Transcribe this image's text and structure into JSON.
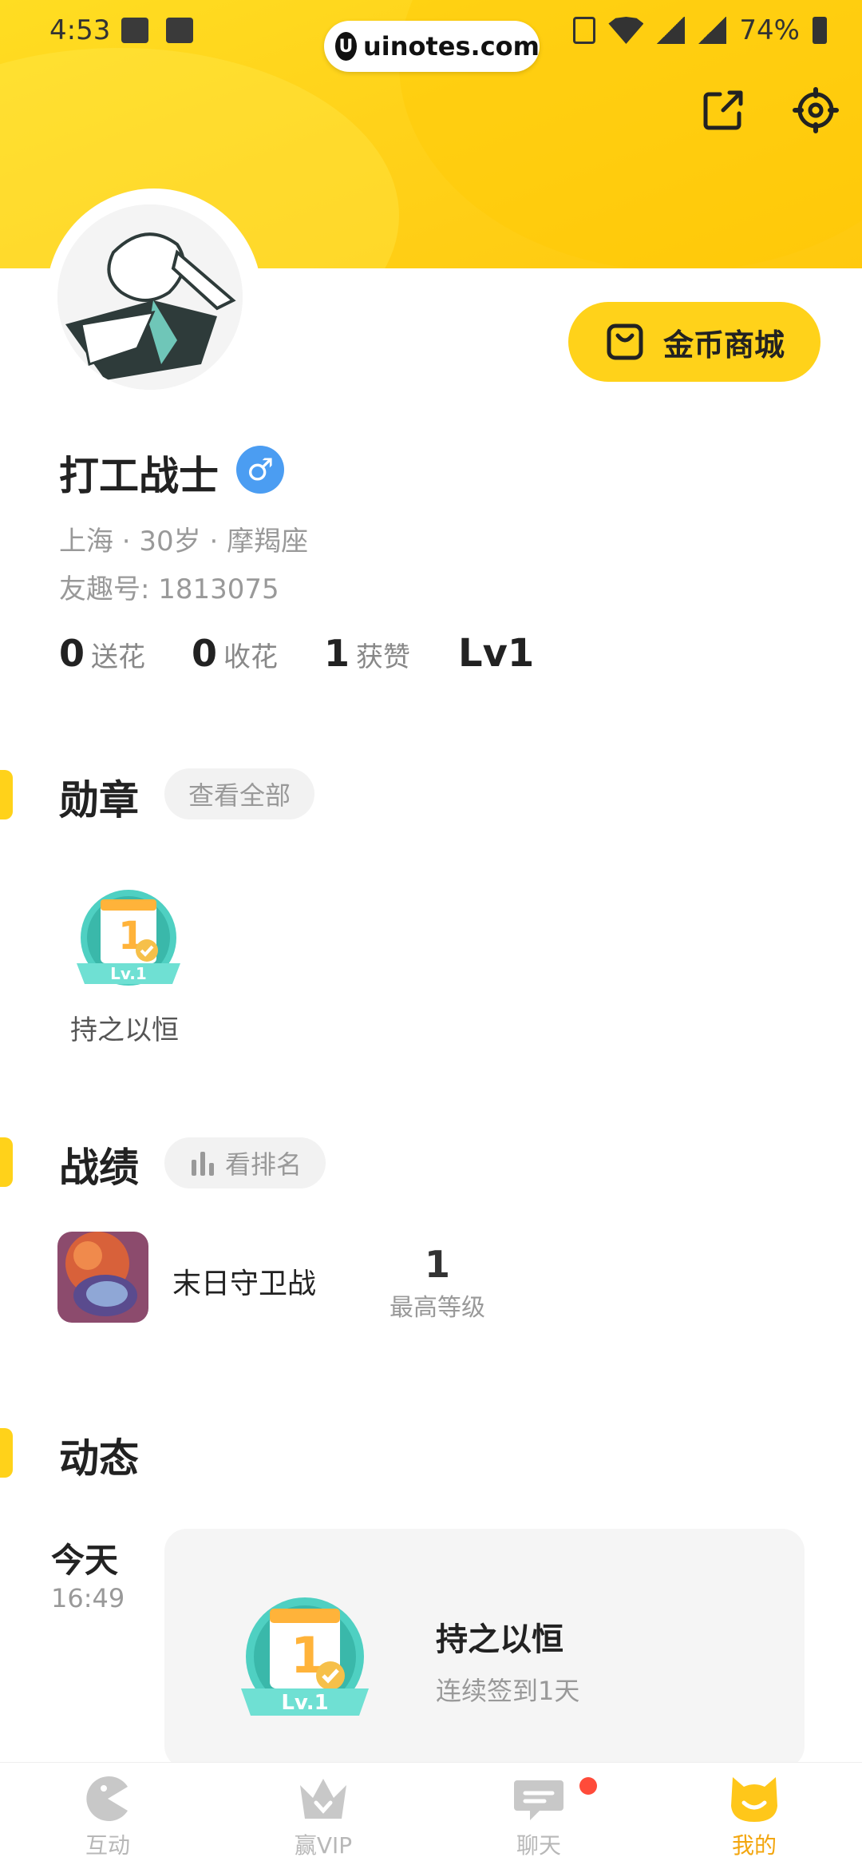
{
  "status_bar": {
    "time": "4:53",
    "battery": "74%"
  },
  "browser": {
    "url": "uinotes.com",
    "logo_letter": "U"
  },
  "header": {
    "share_icon": "share-external-icon",
    "settings_icon": "gear-icon"
  },
  "profile": {
    "username": "打工战士",
    "gender_symbol": "♂",
    "location_line": "上海 · 30岁 · 摩羯座",
    "id_line": "友趣号: 1813075",
    "coin_mall_label": "金币商城",
    "stats": [
      {
        "num": "0",
        "label": "送花"
      },
      {
        "num": "0",
        "label": "收花"
      },
      {
        "num": "1",
        "label": "获赞"
      }
    ],
    "level": "Lv1"
  },
  "medals": {
    "title": "勋章",
    "view_all": "查看全部",
    "items": [
      {
        "label": "持之以恒",
        "badge_num": "1",
        "badge_level": "Lv.1"
      }
    ]
  },
  "records": {
    "title": "战绩",
    "rank_label": "看排名",
    "game": {
      "name": "末日守卫战",
      "level_num": "1",
      "level_label": "最高等级"
    }
  },
  "feed": {
    "title": "动态",
    "day": "今天",
    "time": "16:49",
    "card_title": "持之以恒",
    "card_subtitle": "连续签到1天",
    "badge_num": "1",
    "badge_level": "Lv.1"
  },
  "bottom_nav": [
    {
      "label": "互动",
      "icon": "pacman-icon",
      "active": false
    },
    {
      "label": "赢VIP",
      "icon": "crown-icon",
      "active": false
    },
    {
      "label": "聊天",
      "icon": "chat-bubble-icon",
      "active": false
    },
    {
      "label": "我的",
      "icon": "cat-face-icon",
      "active": true
    }
  ],
  "colors": {
    "brand_yellow": "#ffd21a",
    "active_nav": "#f3a60f",
    "gender_blue": "#4b9df2",
    "notification_red": "#ff4b3a"
  }
}
